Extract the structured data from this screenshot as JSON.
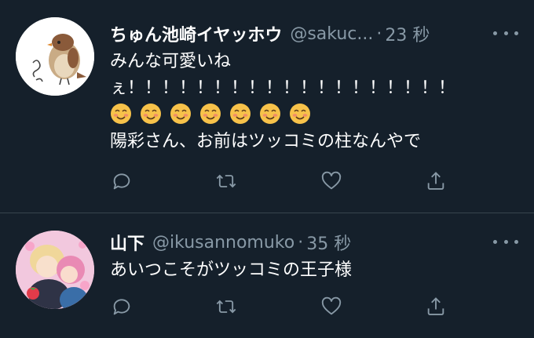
{
  "tweets": [
    {
      "name": "ちゅん池崎イヤッホウ",
      "handle": "@sakuc...",
      "dot": "·",
      "time": "23 秒",
      "lines": [
        "みんな可愛いね",
        "ぇ！！！！！！！！！！！！！！！！！！！"
      ],
      "emoji_count": 7,
      "emoji_name": "smiling-face-with-blush",
      "last_line": "陽彩さん、お前はツッコミの柱なんやで",
      "avatar": "bird-illustration-avatar"
    },
    {
      "name": "山下",
      "handle": "@ikusannomuko",
      "dot": "·",
      "time": "35 秒",
      "lines": [
        "あいつこそがツッコミの王子様"
      ],
      "avatar": "anime-illustration-avatar"
    }
  ],
  "actions": [
    "reply-icon",
    "retweet-icon",
    "like-icon",
    "share-icon"
  ],
  "colors": {
    "background": "#15202b",
    "secondary_text": "#8899a6",
    "divider": "#38444d",
    "emoji_face": "#f7c24a"
  }
}
